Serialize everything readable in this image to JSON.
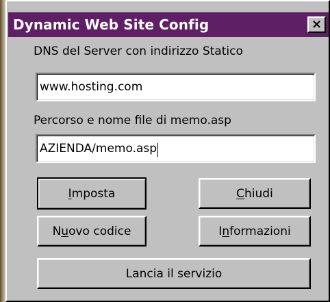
{
  "window": {
    "title": "Dynamic Web Site Config",
    "close_label": "×"
  },
  "fields": [
    {
      "label": "DNS del Server con indirizzo Statico",
      "value": "www.hosting.com"
    },
    {
      "label": "Percorso e nome file di memo.asp",
      "value": "AZIENDA/memo.asp"
    }
  ],
  "buttons": {
    "imposta": {
      "mnemonic": "I",
      "rest": "mposta"
    },
    "chiudi": {
      "mnemonic": "C",
      "rest": "hiudi"
    },
    "nuovo_codice": {
      "before": "N",
      "mnemonic": "u",
      "after": "ovo codice"
    },
    "informazioni": {
      "before": "I",
      "mnemonic": "n",
      "after": "formazioni"
    },
    "lancia": {
      "label": "Lancia il servizio"
    }
  }
}
